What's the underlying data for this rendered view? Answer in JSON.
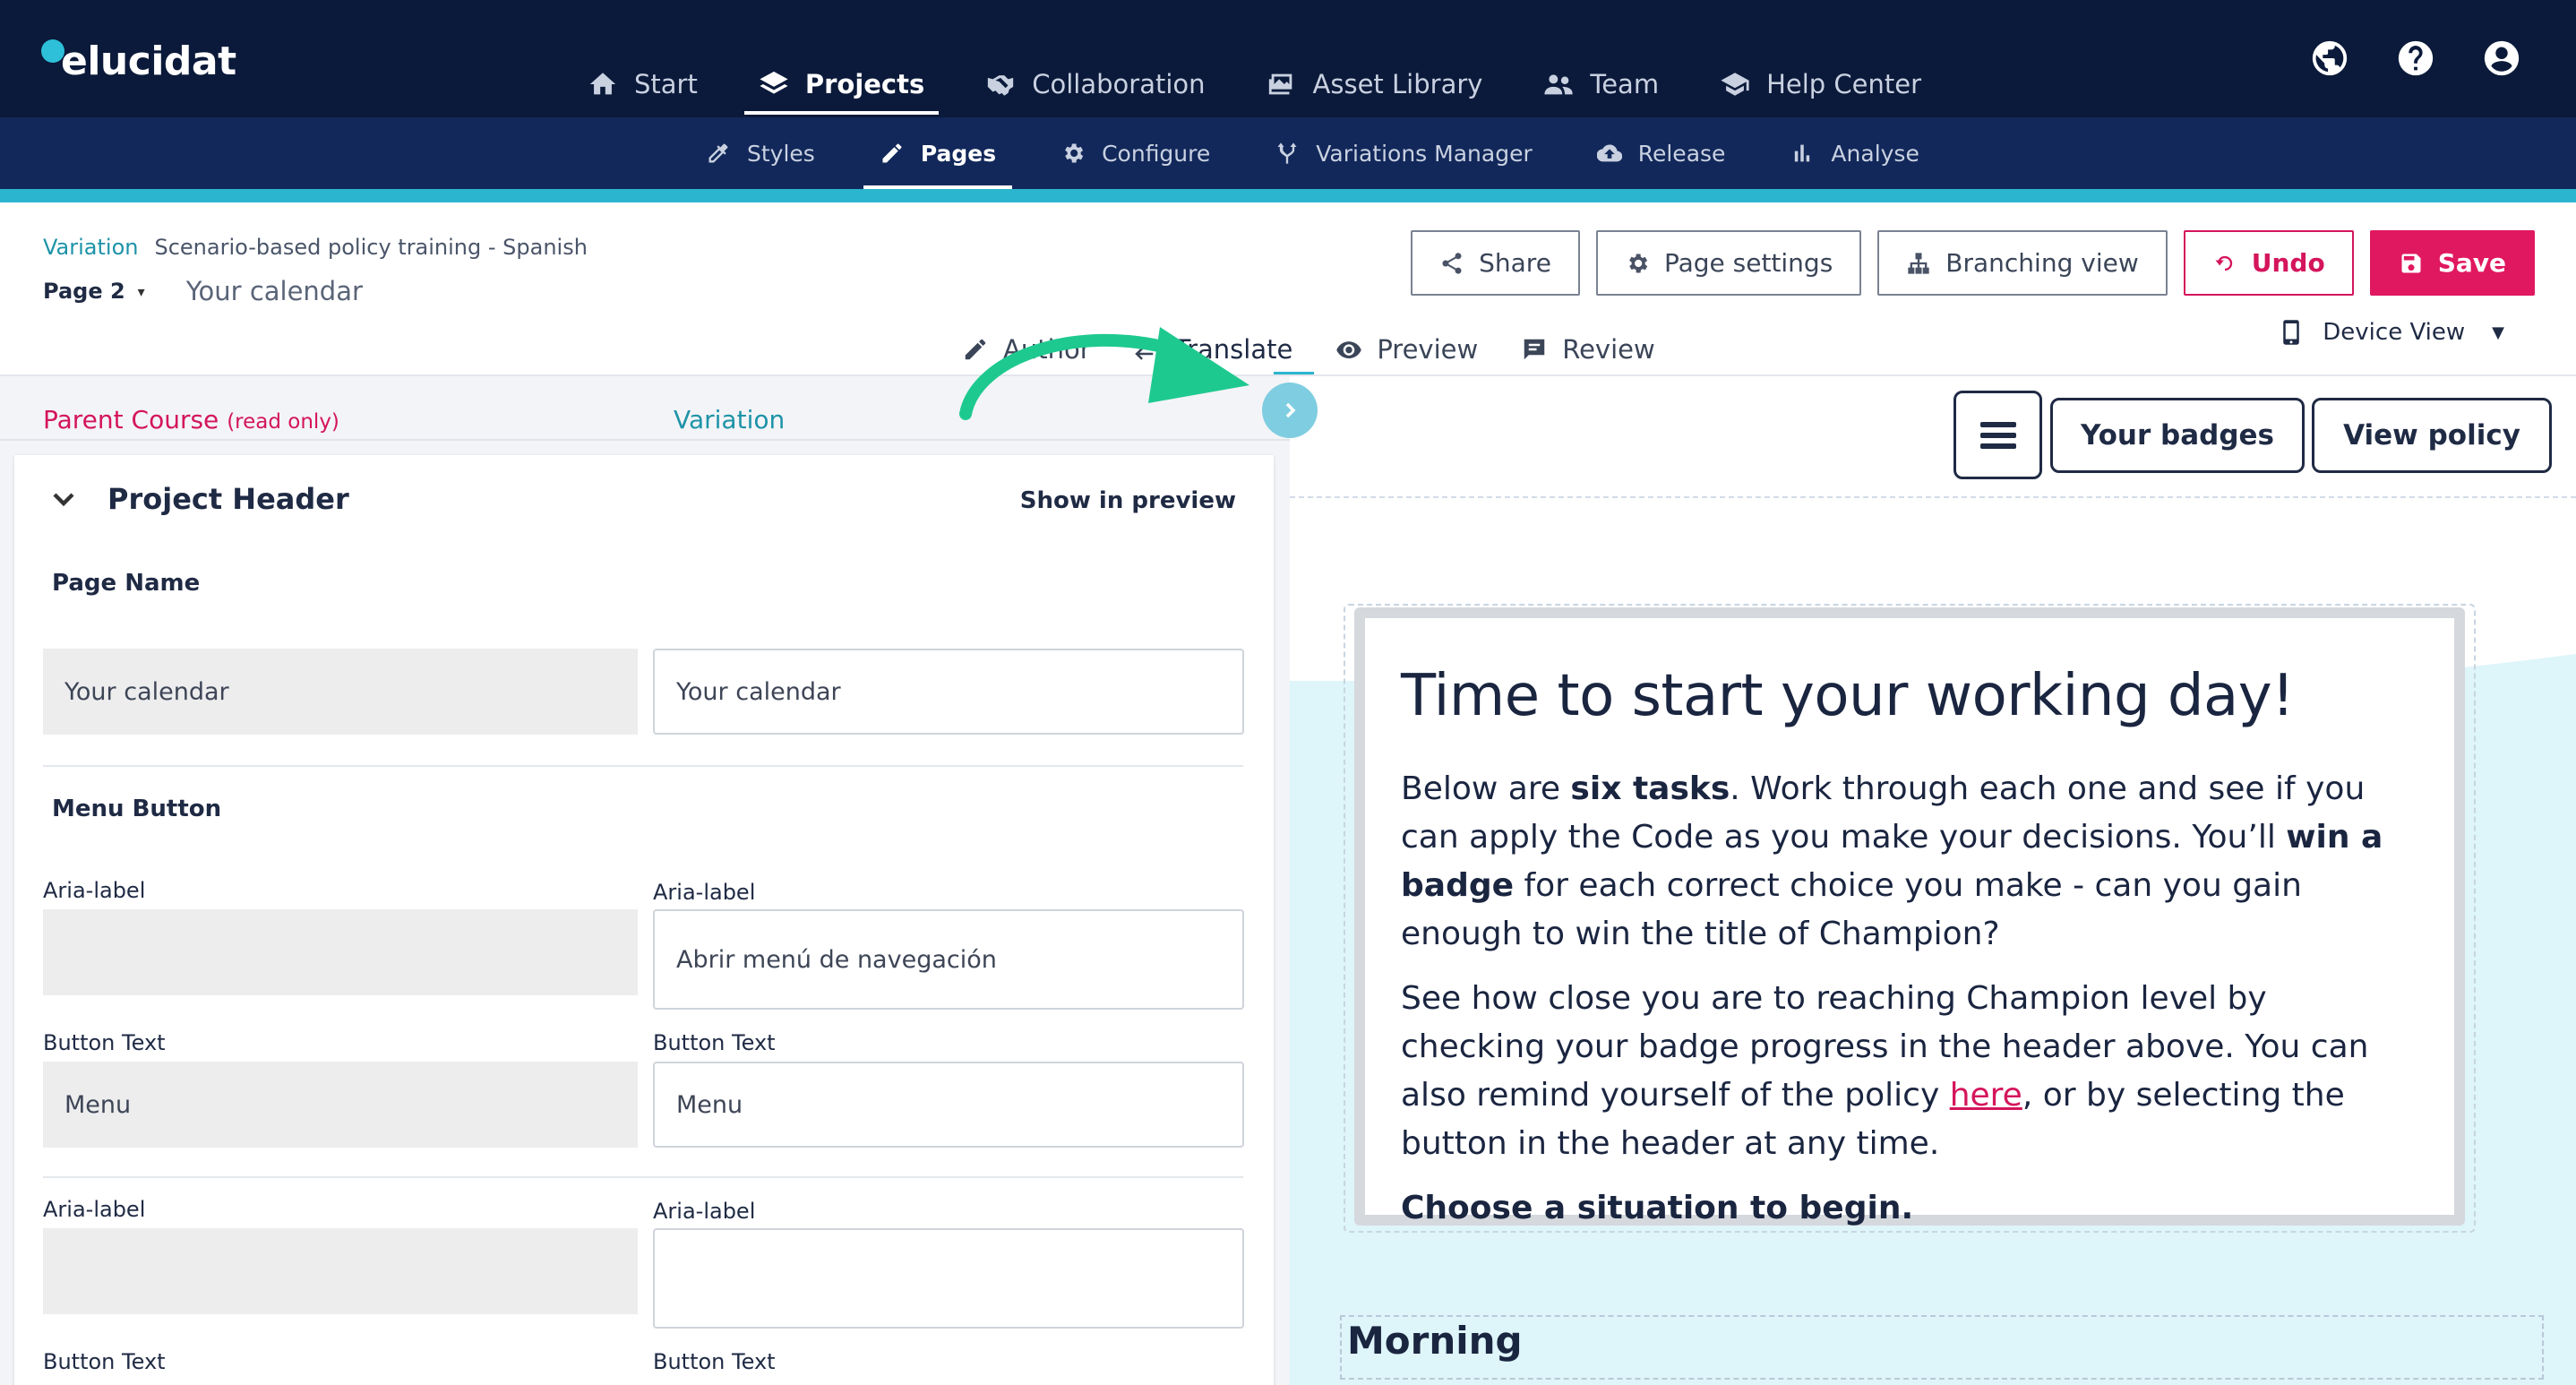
{
  "app": {
    "logo_text": "elucidat"
  },
  "main_nav": [
    {
      "label": "Start",
      "icon": "home-icon"
    },
    {
      "label": "Projects",
      "icon": "layers-icon",
      "active": true
    },
    {
      "label": "Collaboration",
      "icon": "handshake-icon"
    },
    {
      "label": "Asset Library",
      "icon": "images-icon"
    },
    {
      "label": "Team",
      "icon": "people-icon"
    },
    {
      "label": "Help Center",
      "icon": "graduation-cap-icon"
    }
  ],
  "top_icons": [
    "globe-icon",
    "help-icon",
    "user-account-icon"
  ],
  "sub_nav": [
    {
      "label": "Styles",
      "icon": "eyedropper-icon"
    },
    {
      "label": "Pages",
      "icon": "pencil-icon",
      "active": true
    },
    {
      "label": "Configure",
      "icon": "gear-icon"
    },
    {
      "label": "Variations Manager",
      "icon": "fork-icon"
    },
    {
      "label": "Release",
      "icon": "cloud-upload-icon"
    },
    {
      "label": "Analyse",
      "icon": "bar-chart-icon"
    }
  ],
  "breadcrumb": {
    "variation_label": "Variation",
    "course_name": "Scenario-based policy training - Spanish",
    "page_selector": "Page 2",
    "page_title": "Your calendar"
  },
  "actions": {
    "share": "Share",
    "page_settings": "Page settings",
    "branching_view": "Branching view",
    "undo": "Undo",
    "save": "Save"
  },
  "mode_tabs": {
    "author": "Author",
    "translate": "Translate",
    "preview": "Preview",
    "review": "Review",
    "device_view": "Device View"
  },
  "left_pane": {
    "parent_course": "Parent Course",
    "read_only": "(read only)",
    "variation": "Variation",
    "panel_title": "Project Header",
    "show_in_preview": "Show in preview",
    "page_name_title": "Page Name",
    "page_name_ro": "Your calendar",
    "page_name_value": "Your calendar",
    "menu_button_title": "Menu Button",
    "aria_label": "Aria-label",
    "aria_label_1_ro": "",
    "aria_label_1_value": "Abrir menú de navegación",
    "button_text": "Button Text",
    "button_text_1_ro": "Menu",
    "button_text_1_value": "Menu",
    "aria_label_2_ro": "",
    "aria_label_2_value": ""
  },
  "preview": {
    "your_badges": "Your badges",
    "view_policy": "View policy",
    "heading": "Time to start your working day!",
    "p1_a": "Below are ",
    "p1_b": "six tasks",
    "p1_c": ". Work through each one and see if you can apply the Code as you make your decisions. You’ll ",
    "p1_d": "win a badge",
    "p1_e": " for each correct choice you make - can you gain enough to win the title of Champion?",
    "p2_a": "See how close you are to reaching Champion level by checking your badge progress in the header above. You can also remind yourself of the policy ",
    "p2_link": "here",
    "p2_b": ", or by selecting the button in the header at any time.",
    "p3": "Choose a situation to begin.",
    "morning": "Morning"
  },
  "colors": {
    "nav_bg": "#0b1a3a",
    "subnav_bg": "#12285a",
    "teal": "#2bb5cf",
    "pink": "#e0185f",
    "arrow_green": "#1ec98f"
  }
}
